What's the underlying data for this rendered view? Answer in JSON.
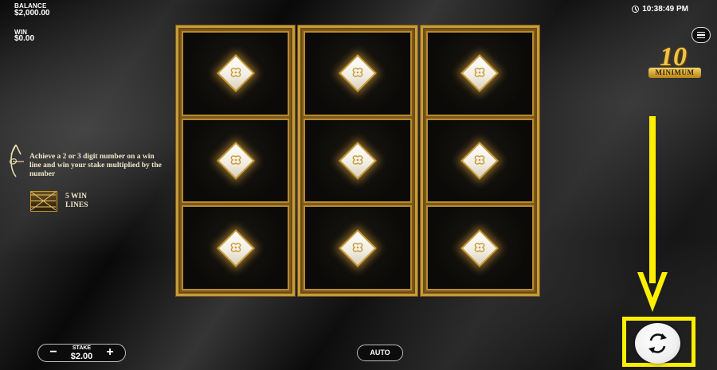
{
  "hud": {
    "balance_label": "BALANCE",
    "balance_value": "$2,000.00",
    "win_label": "WIN",
    "win_value": "$0.00",
    "time": "10:38:49 PM"
  },
  "badge": {
    "big": "10",
    "ribbon": "MINIMUM"
  },
  "info": {
    "text": "Achieve a 2 or 3 digit number on a win line and win your stake multiplied by the number",
    "lines_text": "5 WIN LINES"
  },
  "grid": {
    "columns": 3,
    "rows": 3,
    "symbol": "gold-white-diamond-tile"
  },
  "controls": {
    "stake_label": "STAKE",
    "stake_value": "$2.00",
    "minus": "−",
    "plus": "+",
    "auto_label": "AUTO"
  },
  "highlight": {
    "color": "#ffee00",
    "target": "spin-button"
  },
  "colors": {
    "gold": "#c99b3a",
    "accent": "#ffee00",
    "background": "#111111"
  }
}
